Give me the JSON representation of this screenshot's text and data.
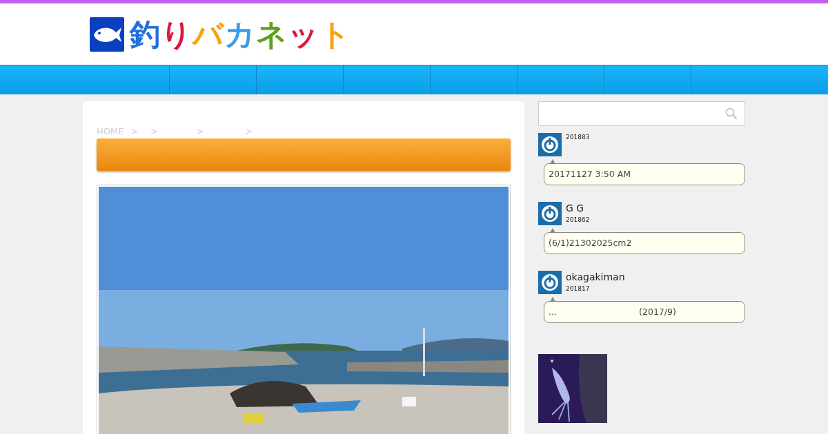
{
  "logo": {
    "chars": [
      {
        "text": "釣",
        "color": "#1f6fe0"
      },
      {
        "text": "り",
        "color": "#e0163c"
      },
      {
        "text": "バ",
        "color": "#f7a20f"
      },
      {
        "text": "カ",
        "color": "#3a9be8"
      },
      {
        "text": "ネ",
        "color": "#5aa21a"
      },
      {
        "text": "ッ",
        "color": "#e0163c"
      },
      {
        "text": "ト",
        "color": "#f7a20f"
      }
    ]
  },
  "breadcrumb": {
    "home": "HOME",
    "separators": [
      ">",
      ">",
      ">",
      ">"
    ]
  },
  "comments": [
    {
      "date": "201883",
      "text": "20171127 3:50 AM"
    },
    {
      "name": "G G",
      "date": "201862",
      "text": "(6/1)21302025cm2"
    },
    {
      "name": "okagakiman",
      "date": "201817",
      "text": "...                              (2017/9)"
    }
  ]
}
